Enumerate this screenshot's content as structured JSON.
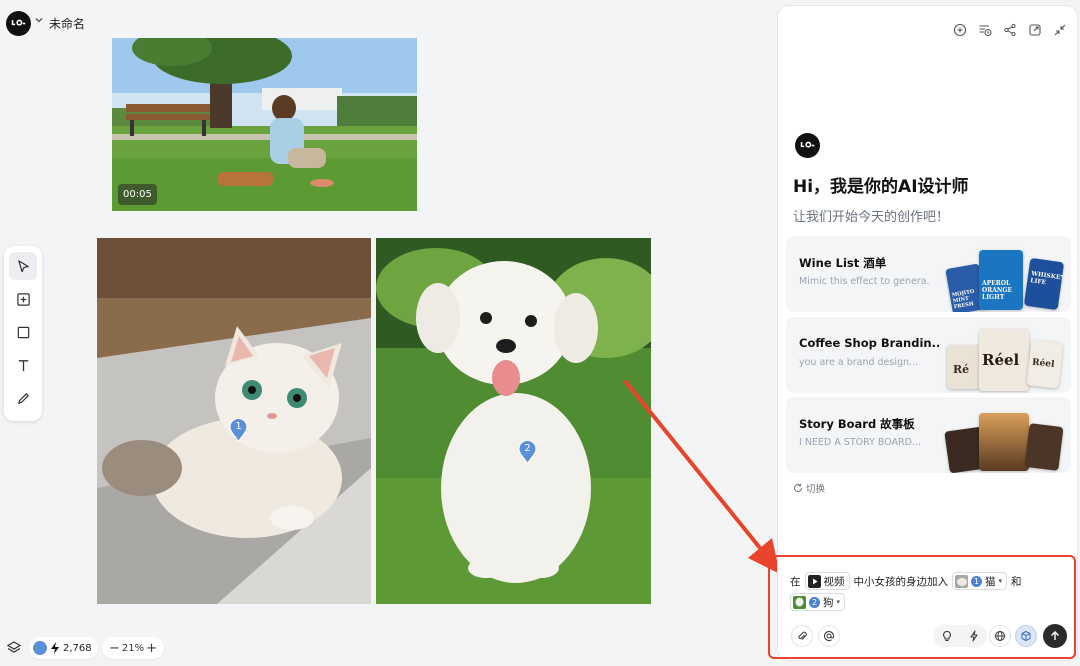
{
  "header": {
    "logo_icon": "lovart-logo-icon",
    "doc_title": "未命名"
  },
  "canvas": {
    "video": {
      "duration_label": "00:05"
    },
    "markers": [
      {
        "label": "1",
        "subject": "cat"
      },
      {
        "label": "2",
        "subject": "dog"
      }
    ]
  },
  "toolbar": {
    "tools": [
      {
        "icon": "cursor-select-icon",
        "active": true
      },
      {
        "icon": "add-frame-icon",
        "active": false
      },
      {
        "icon": "rectangle-icon",
        "active": false
      },
      {
        "icon": "text-tool-icon",
        "active": false
      },
      {
        "icon": "pen-tool-icon",
        "active": false
      }
    ]
  },
  "bottom_bar": {
    "credits": "2,768",
    "zoom_minus": "−",
    "zoom_level": "21%",
    "zoom_plus": "+"
  },
  "panel": {
    "tool_icons": [
      "new-chat-icon",
      "history-icon",
      "share-icon",
      "export-icon",
      "collapse-icon"
    ],
    "greeting": "Hi，我是你的AI设计师",
    "subgreeting": "让我们开始今天的创作吧！",
    "cards": [
      {
        "title": "Wine List  酒单",
        "subtitle": "Mimic this effect to genera..."
      },
      {
        "title": "Coffee Shop Brandin...",
        "subtitle": "you are a brand design..."
      },
      {
        "title": "Story Board  故事板",
        "subtitle": "I NEED A STORY BOARD..."
      }
    ],
    "card_thumb_text": {
      "wine_a": "MOJITO MINT FRESH",
      "wine_b": "APEROL ORANGE LIGHT",
      "wine_c": "WHISKEY LIFE",
      "coffee_a": "Ré",
      "coffee_b": "Réel",
      "coffee_c": "Réel"
    },
    "switch_label": "切换"
  },
  "composer": {
    "text_in": "在",
    "chip_video": "视频",
    "text_middle": "中小女孩的身边加入",
    "chip_cat_num": "1",
    "chip_cat": "猫",
    "text_and": "和",
    "chip_dog_num": "2",
    "chip_dog": "狗"
  },
  "colors": {
    "accent_red": "#e8452c",
    "marker_blue": "#5b8fd9",
    "send_dark": "#2b2b2b"
  }
}
